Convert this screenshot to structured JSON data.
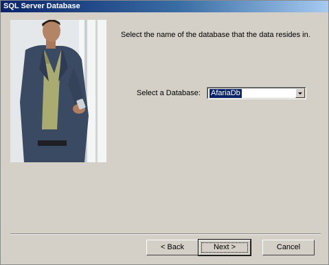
{
  "window": {
    "title": "SQL Server Database"
  },
  "main": {
    "instruction": "Select the name of the database that the data resides in.",
    "database_label": "Select a Database:",
    "database_value": "AfariaDb"
  },
  "buttons": {
    "back": "< Back",
    "next": "Next >",
    "cancel": "Cancel"
  }
}
